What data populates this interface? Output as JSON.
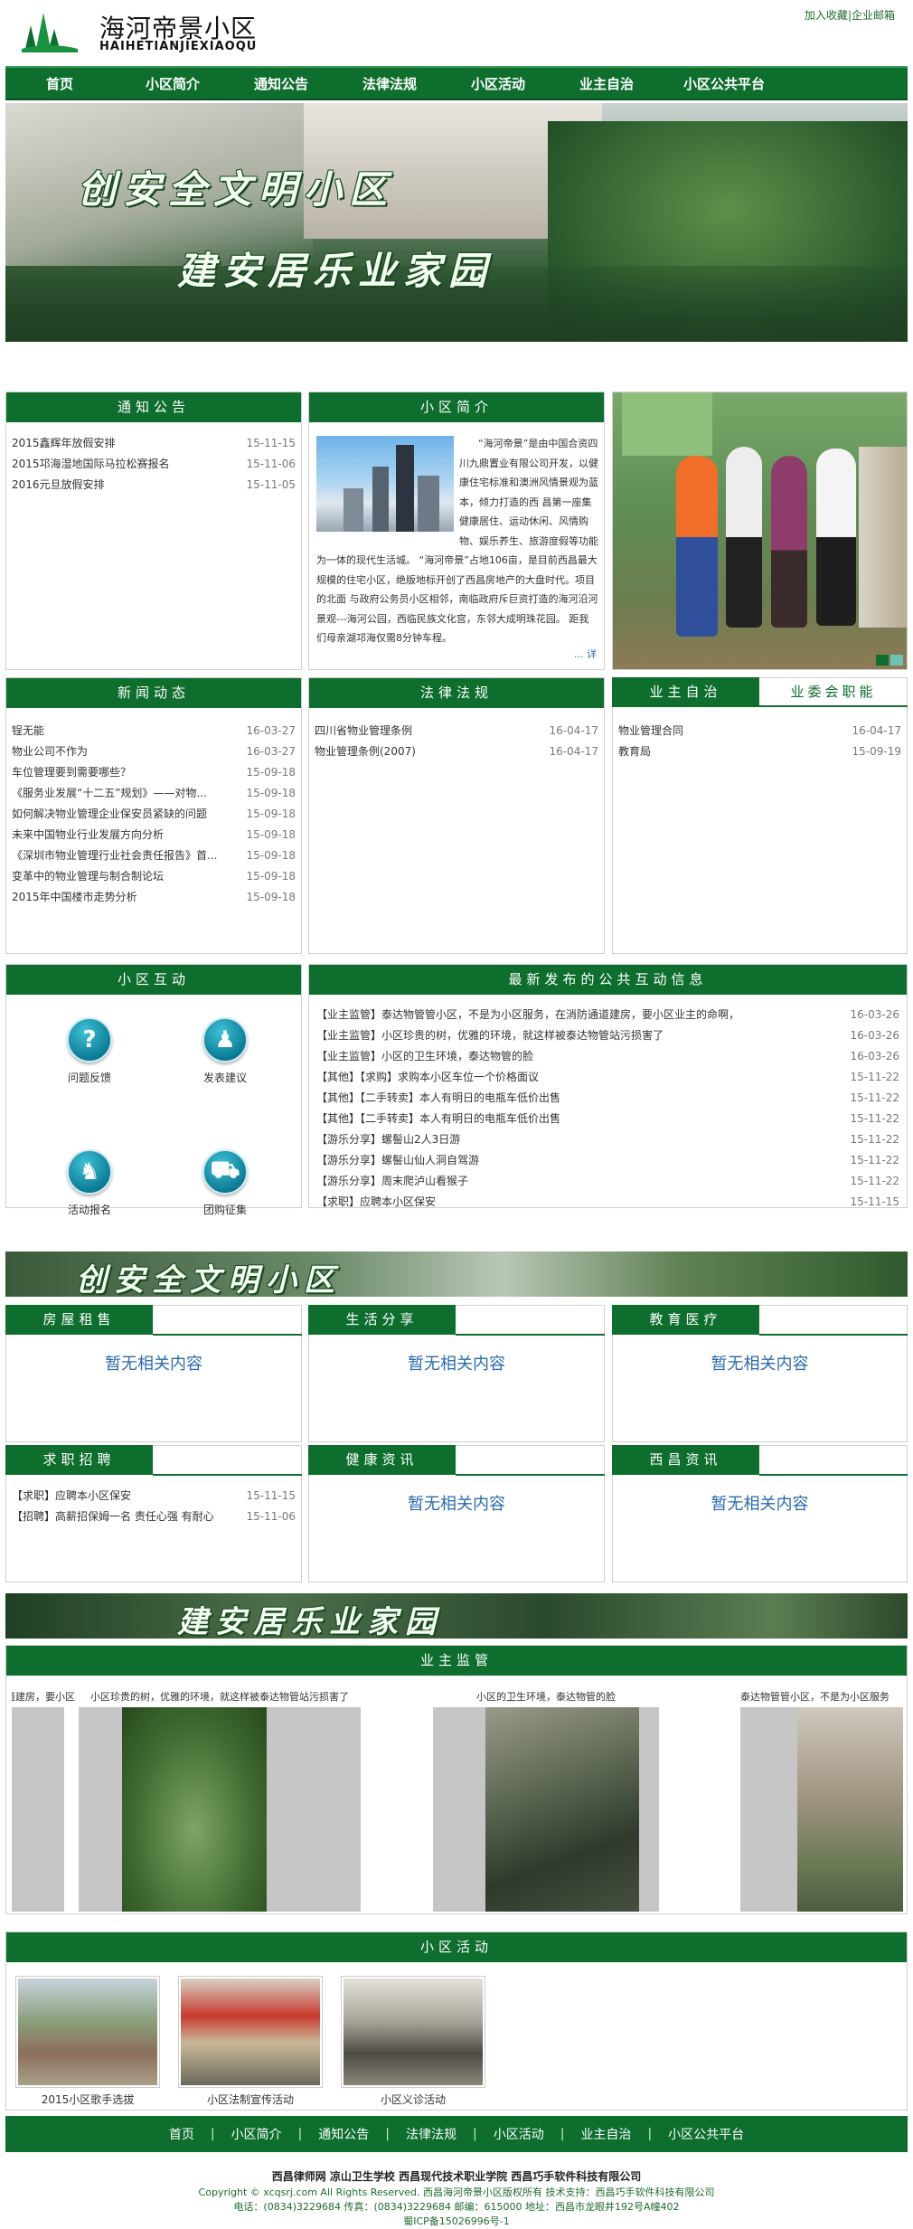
{
  "header": {
    "title": "海河帝景小区",
    "subtitle": "HAIHETIANJIEXIAOQU",
    "links": [
      "加入收藏",
      "企业邮箱"
    ],
    "link_sep": "|"
  },
  "nav": [
    "首页",
    "小区简介",
    "通知公告",
    "法律法规",
    "小区活动",
    "业主自治",
    "小区公共平台"
  ],
  "banner": {
    "line1": "创安全文明小区",
    "line2": "建安居乐业家园"
  },
  "notice": {
    "title": "通知公告",
    "items": [
      {
        "t": "2015鑫辉年放假安排",
        "d": "15-11-15"
      },
      {
        "t": "2015邛海湿地国际马拉松赛报名",
        "d": "15-11-06"
      },
      {
        "t": "2016元旦放假安排",
        "d": "15-11-05"
      }
    ]
  },
  "intro": {
    "title": "小区简介",
    "text": "      “海河帝景”是由中国合资四川九鼎置业有限公司开发，以健康住宅标准和澳洲风情景观为蓝本，倾力打造的西 昌第一座集健康居住、运动休闲、风情购物、娱乐养生、旅游度假等功能为一体的现代生活城。 “海河帝景”占地106亩，是目前西昌最大规模的住宅小区，绝版地标开创了西昌房地产的大盘时代。项目的北面 与政府公务员小区相邻，南临政府斥巨资打造的海河沿河景观---海河公园，西临民族文化宫，东邻大成明珠花园。 距我们母亲湖邛海仅需8分钟车程。",
    "more": "... 详"
  },
  "news": {
    "title": "新闻动态",
    "items": [
      {
        "t": "锃无能",
        "d": "16-03-27"
      },
      {
        "t": "物业公司不作为",
        "d": "16-03-27"
      },
      {
        "t": "车位管理要到需要哪些？",
        "d": "15-09-18"
      },
      {
        "t": "《服务业发展“十二五”规划》——对物...",
        "d": "15-09-18"
      },
      {
        "t": "如何解决物业管理企业保安员紧缺的问题",
        "d": "15-09-18"
      },
      {
        "t": "未来中国物业行业发展方向分析",
        "d": "15-09-18"
      },
      {
        "t": "《深圳市物业管理行业社会责任报告》首...",
        "d": "15-09-18"
      },
      {
        "t": "变革中的物业管理与制合制论坛",
        "d": "15-09-18"
      },
      {
        "t": "2015年中国楼市走势分析",
        "d": "15-09-18"
      }
    ]
  },
  "law": {
    "title": "法律法规",
    "items": [
      {
        "t": "四川省物业管理条例",
        "d": "16-04-17"
      },
      {
        "t": "物业管理条例(2007)",
        "d": "16-04-17"
      }
    ]
  },
  "owner": {
    "tab1": "业主自治",
    "tab2": "业委会职能",
    "items": [
      {
        "t": "物业管理合同",
        "d": "16-04-17"
      },
      {
        "t": "教育局",
        "d": "15-09-19"
      }
    ]
  },
  "interact": {
    "title": "小区互动",
    "buttons": [
      {
        "label": "问题反馈",
        "glyph": "?"
      },
      {
        "label": "发表建议",
        "glyph": "♟"
      },
      {
        "label": "活动报名",
        "glyph": "♞"
      },
      {
        "label": "团购征集",
        "glyph": "⛟"
      }
    ]
  },
  "public_info": {
    "title": "最新发布的公共互动信息",
    "items": [
      {
        "t": "【业主监管】泰达物管管小区，不是为小区服务，在消防通道建房，要小区业主的命啊，",
        "d": "16-03-26"
      },
      {
        "t": "【业主监管】小区珍贵的树，优雅的环境，就这样被泰达物管站污损害了",
        "d": "16-03-26"
      },
      {
        "t": "【业主监管】小区的卫生环境，泰达物管的脸",
        "d": "16-03-26"
      },
      {
        "t": "【其他】【求购】求购本小区车位一个价格面议",
        "d": "15-11-22"
      },
      {
        "t": "【其他】【二手转卖】本人有明日的电瓶车低价出售",
        "d": "15-11-22"
      },
      {
        "t": "【其他】【二手转卖】本人有明日的电瓶车低价出售",
        "d": "15-11-22"
      },
      {
        "t": "【游乐分享】螺髻山2人3日游",
        "d": "15-11-22"
      },
      {
        "t": "【游乐分享】螺髻山仙人洞自驾游",
        "d": "15-11-22"
      },
      {
        "t": "【游乐分享】周末爬泸山看猴子",
        "d": "15-11-22"
      },
      {
        "t": "【求职】应聘本小区保安",
        "d": "15-11-15"
      }
    ]
  },
  "categories": [
    {
      "title": "房屋租售",
      "empty": "暂无相关内容"
    },
    {
      "title": "生活分享",
      "empty": "暂无相关内容"
    },
    {
      "title": "教育医疗",
      "empty": "暂无相关内容"
    },
    {
      "title": "求职招聘",
      "items": [
        {
          "t": "【求职】应聘本小区保安",
          "d": "15-11-15"
        },
        {
          "t": "【招聘】高薪招保姆一名 责任心强 有耐心",
          "d": "15-11-06"
        }
      ]
    },
    {
      "title": "健康资讯",
      "empty": "暂无相关内容"
    },
    {
      "title": "西昌资讯",
      "empty": "暂无相关内容"
    }
  ],
  "supervise": {
    "title": "业主监管",
    "captions": [
      "消防通道建房，要小区",
      "小区珍贵的树，优雅的环境，就这样被泰达物管站污损害了",
      "小区的卫生环境，泰达物管的脸",
      "泰达物管管小区，不是为小区服务"
    ]
  },
  "activities": {
    "title": "小区活动",
    "items": [
      "2015小区歌手选拔",
      "小区法制宣传活动",
      "小区义诊活动"
    ]
  },
  "footer": {
    "nav": [
      "首页",
      "小区简介",
      "通知公告",
      "法律法规",
      "小区活动",
      "业主自治",
      "小区公共平台"
    ],
    "nav_sep": "|",
    "links": "西昌律师网   凉山卫生学校   西昌现代技术职业学院   西昌巧手软件科技有限公司",
    "copyright": "Copyright © xcqsrj.com All Rights Reserved. 西昌海河帝景小区版权所有 技术支持：西昌巧手软件科技有限公司",
    "contact": "电话：(0834)3229684 传真：(0834)3229684 邮编：615000 地址：西昌市龙眼井192号A幢402",
    "icp": "蜀ICP备15026996号-1"
  },
  "colors": {
    "brand": "#0d6e2e",
    "empty_text": "#2a6ab0"
  }
}
